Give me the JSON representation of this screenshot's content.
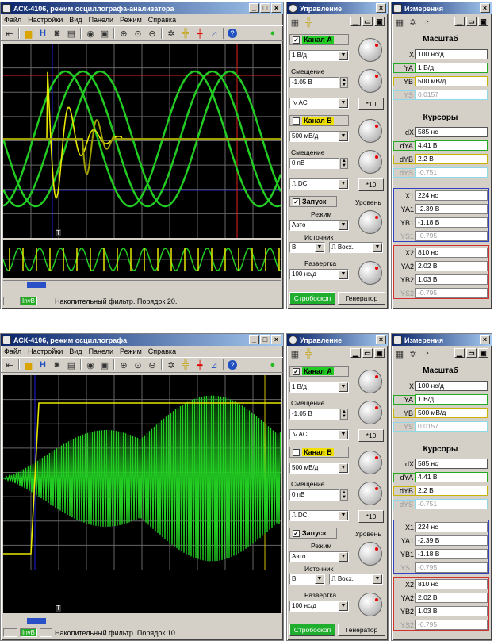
{
  "windows": [
    {
      "title": "АСК-4106, режим осциллографа-анализатора",
      "menu": [
        "Файл",
        "Настройки",
        "Вид",
        "Панели",
        "Режим",
        "Справка"
      ],
      "status": {
        "inv": "InvB",
        "filter": "Накопительный фильтр. Порядок 20."
      },
      "marker": "T"
    },
    {
      "title": "АСК-4106, режим осциллографа",
      "menu": [
        "Файл",
        "Настройки",
        "Вид",
        "Панели",
        "Режим",
        "Справка"
      ],
      "status": {
        "inv": "InvB",
        "filter": "Накопительный фильтр. Порядок 10."
      },
      "marker": "T"
    }
  ],
  "control": {
    "title": "Управление",
    "channel_a": {
      "label": "Канал A",
      "scale": "1 В/д",
      "offset_label": "Смещение",
      "offset": "-1.05 В",
      "coupling": "AC",
      "x10": "*10"
    },
    "channel_b": {
      "label": "Канал B",
      "scale": "500 мВ/д",
      "offset_label": "Смещение",
      "offset": "0 пВ",
      "coupling": "DC",
      "x10": "*10"
    },
    "trigger": {
      "label": "Запуск",
      "level": "Уровень",
      "mode_label": "Режим",
      "mode": "Авто",
      "source_label": "Источник",
      "source": "B",
      "edge": "Восх."
    },
    "sweep": {
      "label": "Развертка",
      "value": "100 нс/д"
    },
    "strobe": "Стробоскоп",
    "generator": "Генератор"
  },
  "measure": {
    "title": "Измерения",
    "scale_header": "Масштаб",
    "scale": [
      {
        "k": "X",
        "v": "100 нс/д"
      },
      {
        "k": "YA",
        "v": "1 В/д"
      },
      {
        "k": "YB",
        "v": "500 мВ/д"
      },
      {
        "k": "YS",
        "v": "0.0157"
      }
    ],
    "cursor_header": "Курсоры",
    "deltas": [
      {
        "k": "dX",
        "v": "585 нс"
      },
      {
        "k": "dYA",
        "v": "4.41 В"
      },
      {
        "k": "dYB",
        "v": "2.2 В"
      },
      {
        "k": "dYS",
        "v": "-0.751"
      }
    ],
    "c1": [
      {
        "k": "X1",
        "v": "224 нс"
      },
      {
        "k": "YA1",
        "v": "-2.39 В"
      },
      {
        "k": "YB1",
        "v": "-1.18 В"
      },
      {
        "k": "YS1",
        "v": "-0.795"
      }
    ],
    "c2": [
      {
        "k": "X2",
        "v": "810 нс"
      },
      {
        "k": "YA2",
        "v": "2.02 В"
      },
      {
        "k": "YB2",
        "v": "1.03 В"
      },
      {
        "k": "YS2",
        "v": "-0.795"
      }
    ]
  },
  "colors": {
    "trace_a": "#e8e800",
    "trace_b": "#22cc22",
    "grid": "#666666",
    "cursor_red": "#e02020",
    "cursor_blue": "#2020e0"
  }
}
